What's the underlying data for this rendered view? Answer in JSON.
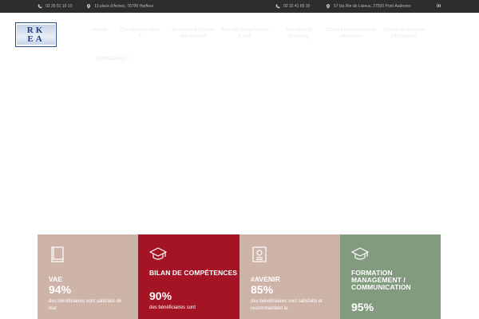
{
  "topbar": {
    "phone1": "02 35 51 10 10",
    "address1": "13 place d'Armes, 76700 Harfleur",
    "phone2": "02 32 41 85 35",
    "address2": "57 bis Rte de Lisieux, 27500 Pont-Audemer",
    "social": "in"
  },
  "logo": {
    "line1": "RK",
    "line2": "EA"
  },
  "nav": [
    {
      "label": "Accueil"
    },
    {
      "label": "Qui sommes-nous ?"
    },
    {
      "label": "Modalités & Soutien Administratif"
    },
    {
      "label": "Bilan de Compétences & VAE"
    },
    {
      "label": "Formation & Coaching"
    },
    {
      "label": "Conseil en Ressources Humaines"
    },
    {
      "label": "Conseil en Création d'Entreprise"
    },
    {
      "label": "Satisfaction(s) !"
    }
  ],
  "cards": [
    {
      "icon": "book-icon",
      "title": "VAE",
      "percent": "94%",
      "desc": "des bénéficiaires sont satisfaits de leur",
      "bg": "#cdb3a8"
    },
    {
      "icon": "graduation-cap-icon",
      "title": "BILAN DE COMPÉTENCES",
      "percent": "90%",
      "desc": "des bénéficiaires sont",
      "bg": "#a41425"
    },
    {
      "icon": "certificate-icon",
      "title": "#AVENIR",
      "percent": "85%",
      "desc": "des bénéficiaires sont satisfaits et recommandent la",
      "bg": "#cdb3a8"
    },
    {
      "icon": "graduation-cap-icon",
      "title": "FORMATION MANAGEMENT / COMMUNICATION",
      "percent": "95%",
      "desc": "",
      "bg": "#829a7d"
    }
  ]
}
